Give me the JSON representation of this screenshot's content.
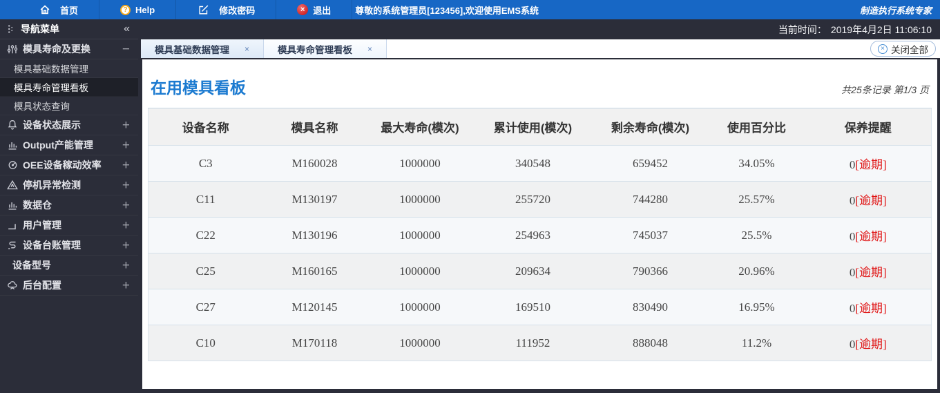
{
  "topbar": {
    "home": "首页",
    "help": "Help",
    "change_password": "修改密码",
    "logout": "退出",
    "welcome": "尊敬的系统管理员[123456],欢迎使用EMS系统",
    "brand": "制造执行系统专家"
  },
  "statusbar": {
    "time_label": "当前时间：",
    "time_value": "2019年4月2日 11:06:10"
  },
  "sidebar": {
    "title": "导航菜单",
    "groups": [
      {
        "label": "模具寿命及更换",
        "icon": "sliders-icon",
        "state": "expanded",
        "children": [
          "模具基础数据管理",
          "模具寿命管理看板",
          "模具状态查询"
        ],
        "selected_child": "模具寿命管理看板"
      },
      {
        "label": "设备状态展示",
        "icon": "bell-icon"
      },
      {
        "label": "Output产能管理",
        "icon": "bar-chart-icon"
      },
      {
        "label": "OEE设备稼动效率",
        "icon": "gauge-icon"
      },
      {
        "label": "停机异常检测",
        "icon": "warning-icon"
      },
      {
        "label": "数据仓",
        "icon": "bar-chart-icon"
      },
      {
        "label": "用户管理",
        "icon": "user-icon"
      },
      {
        "label": "设备台账管理",
        "icon": "flow-icon"
      },
      {
        "label": "设备型号",
        "icon": "none"
      },
      {
        "label": "后台配置",
        "icon": "cloud-icon"
      }
    ]
  },
  "icons": {
    "collapse": "«",
    "minus": "−",
    "plus": "+",
    "tab_close": "×",
    "close_circle": "×",
    "logout_x": "×",
    "help_q": "?"
  },
  "tabs": [
    {
      "label": "模具基础数据管理",
      "active": false
    },
    {
      "label": "模具寿命管理看板",
      "active": true
    }
  ],
  "close_all_label": "关闭全部",
  "page": {
    "title": "在用模具看板",
    "record_info": "共25条记录 第1/3 页"
  },
  "table": {
    "headers": [
      "设备名称",
      "模具名称",
      "最大寿命(模次)",
      "累计使用(模次)",
      "剩余寿命(模次)",
      "使用百分比",
      "保养提醒"
    ],
    "rows": [
      {
        "device": "C3",
        "mold": "M160028",
        "max": "1000000",
        "used": "340548",
        "remain": "659452",
        "percent": "34.05%",
        "maintain": "0",
        "overdue": "[逾期]"
      },
      {
        "device": "C11",
        "mold": "M130197",
        "max": "1000000",
        "used": "255720",
        "remain": "744280",
        "percent": "25.57%",
        "maintain": "0",
        "overdue": "[逾期]"
      },
      {
        "device": "C22",
        "mold": "M130196",
        "max": "1000000",
        "used": "254963",
        "remain": "745037",
        "percent": "25.5%",
        "maintain": "0",
        "overdue": "[逾期]"
      },
      {
        "device": "C25",
        "mold": "M160165",
        "max": "1000000",
        "used": "209634",
        "remain": "790366",
        "percent": "20.96%",
        "maintain": "0",
        "overdue": "[逾期]"
      },
      {
        "device": "C27",
        "mold": "M120145",
        "max": "1000000",
        "used": "169510",
        "remain": "830490",
        "percent": "16.95%",
        "maintain": "0",
        "overdue": "[逾期]"
      },
      {
        "device": "C10",
        "mold": "M170118",
        "max": "1000000",
        "used": "111952",
        "remain": "888048",
        "percent": "11.2%",
        "maintain": "0",
        "overdue": "[逾期]"
      }
    ]
  },
  "colors": {
    "topbar_blue": "#1767c5",
    "sidebar_dark": "#2b2d39",
    "title_blue": "#1b7ad0",
    "overdue_red": "#e01515"
  }
}
